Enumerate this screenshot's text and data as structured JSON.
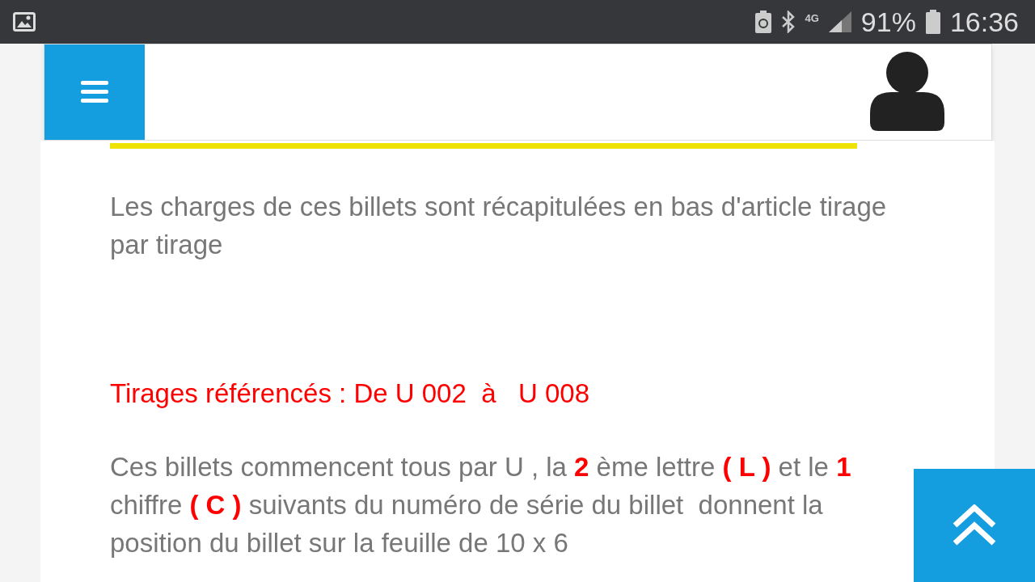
{
  "status_bar": {
    "network": "4G",
    "battery_percent": "91%",
    "time": "16:36"
  },
  "article": {
    "intro": "Les charges de ces billets sont récapitulées en bas d'article tirage par tirage",
    "highlight": "Tirages référencés : De U 002  à   U 008",
    "body": "Ces billets commencent tous par U , la **2** ème lettre **( L )** et le **1** chiffre **( C )** suivants du numéro de série du billet  donnent la position du billet sur la feuille de 10 x 6"
  }
}
